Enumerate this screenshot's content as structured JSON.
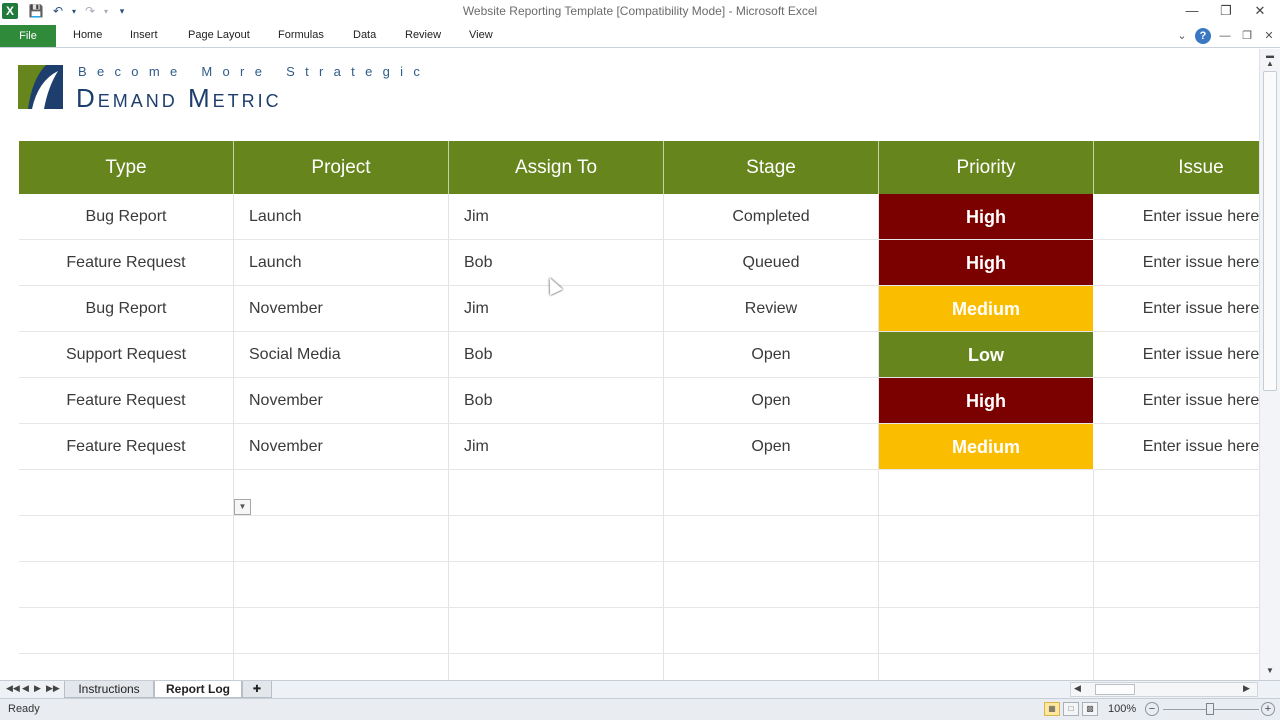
{
  "window": {
    "title": "Website Reporting Template  [Compatibility Mode]  -  Microsoft Excel",
    "app_letter": "X"
  },
  "ribbon": {
    "tabs": [
      "File",
      "Home",
      "Insert",
      "Page Layout",
      "Formulas",
      "Data",
      "Review",
      "View"
    ]
  },
  "logo": {
    "tagline": "Become More Strategic",
    "name": "Demand Metric",
    "colors": {
      "green": "#66851d",
      "navy": "#1e3f6e"
    }
  },
  "table": {
    "headers": [
      "Type",
      "Project",
      "Assign To",
      "Stage",
      "Priority",
      "Issue"
    ],
    "header_color": "#66851d",
    "rows": [
      {
        "type": "Bug Report",
        "project": "Launch",
        "assign_to": "Jim",
        "stage": "Completed",
        "priority": "High",
        "issue": "Enter issue here"
      },
      {
        "type": "Feature Request",
        "project": "Launch",
        "assign_to": "Bob",
        "stage": "Queued",
        "priority": "High",
        "issue": "Enter issue here"
      },
      {
        "type": "Bug Report",
        "project": "November",
        "assign_to": "Jim",
        "stage": "Review",
        "priority": "Medium",
        "issue": "Enter issue here"
      },
      {
        "type": "Support Request",
        "project": "Social Media",
        "assign_to": "Bob",
        "stage": "Open",
        "priority": "Low",
        "issue": "Enter issue here"
      },
      {
        "type": "Feature Request",
        "project": "November",
        "assign_to": "Bob",
        "stage": "Open",
        "priority": "High",
        "issue": "Enter issue here"
      },
      {
        "type": "Feature Request",
        "project": "November",
        "assign_to": "Jim",
        "stage": "Open",
        "priority": "Medium",
        "issue": "Enter issue here"
      }
    ],
    "empty_rows": 5,
    "priority_colors": {
      "High": "#7b0000",
      "Medium": "#fbbd00",
      "Low": "#66851d"
    }
  },
  "sheet_tabs": [
    {
      "label": "Instructions",
      "active": false
    },
    {
      "label": "Report Log",
      "active": true
    }
  ],
  "status": {
    "mode": "Ready",
    "zoom": "100%"
  }
}
